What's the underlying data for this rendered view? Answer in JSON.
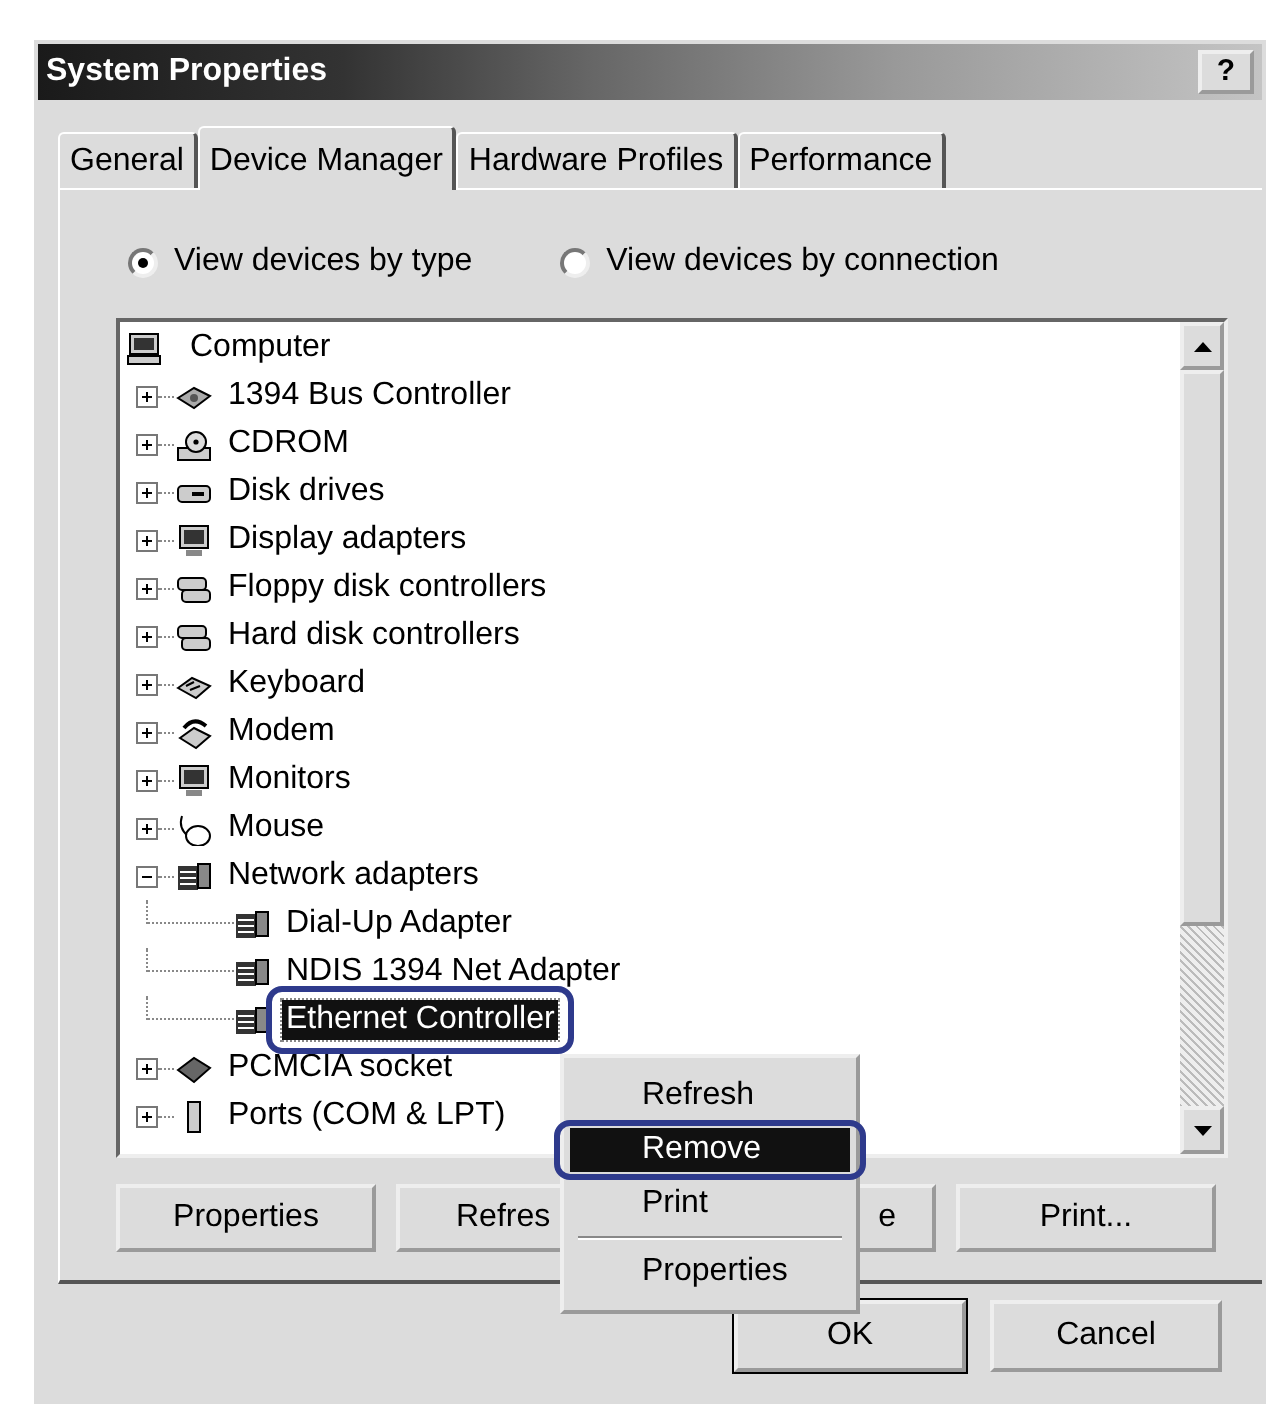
{
  "window": {
    "title": "System Properties",
    "help_button": "?"
  },
  "tabs": [
    {
      "label": "General",
      "selected": false
    },
    {
      "label": "Device Manager",
      "selected": true
    },
    {
      "label": "Hardware Profiles",
      "selected": false
    },
    {
      "label": "Performance",
      "selected": false
    }
  ],
  "view_options": [
    {
      "label": "View devices by type",
      "selected": true
    },
    {
      "label": "View devices by connection",
      "selected": false
    }
  ],
  "tree": {
    "label": "Computer",
    "selected": false,
    "children": [
      {
        "label": "1394 Bus Controller",
        "expanded": false,
        "selected": false
      },
      {
        "label": "CDROM",
        "expanded": false,
        "selected": false
      },
      {
        "label": "Disk drives",
        "expanded": false,
        "selected": false
      },
      {
        "label": "Display adapters",
        "expanded": false,
        "selected": false
      },
      {
        "label": "Floppy disk controllers",
        "expanded": false,
        "selected": false
      },
      {
        "label": "Hard disk controllers",
        "expanded": false,
        "selected": false
      },
      {
        "label": "Keyboard",
        "expanded": false,
        "selected": false
      },
      {
        "label": "Modem",
        "expanded": false,
        "selected": false
      },
      {
        "label": "Monitors",
        "expanded": false,
        "selected": false
      },
      {
        "label": "Mouse",
        "expanded": false,
        "selected": false
      },
      {
        "label": "Network adapters",
        "expanded": true,
        "selected": false,
        "children": [
          {
            "label": "Dial-Up Adapter",
            "selected": false,
            "highlighted": false
          },
          {
            "label": "NDIS 1394 Net Adapter",
            "selected": false,
            "highlighted": false
          },
          {
            "label": "Ethernet Controller",
            "selected": true,
            "highlighted": true
          }
        ]
      },
      {
        "label": "PCMCIA socket",
        "expanded": false,
        "selected": false
      },
      {
        "label": "Ports (COM & LPT)",
        "expanded": false,
        "selected": false
      }
    ]
  },
  "buttons": [
    {
      "label": "Properties"
    },
    {
      "label": "Refres"
    },
    {
      "label": "e"
    },
    {
      "label": "Print..."
    }
  ],
  "context_menu": [
    {
      "kind": "item",
      "label": "Refresh",
      "selected": false,
      "highlighted": false
    },
    {
      "kind": "item",
      "label": "Remove",
      "selected": true,
      "highlighted": true
    },
    {
      "kind": "item",
      "label": "Print",
      "selected": false,
      "highlighted": false
    },
    {
      "kind": "separator"
    },
    {
      "kind": "item",
      "label": "Properties",
      "selected": false,
      "highlighted": false
    }
  ],
  "dialog_buttons": [
    {
      "label": "OK",
      "default": true
    },
    {
      "label": "Cancel",
      "default": false
    }
  ]
}
